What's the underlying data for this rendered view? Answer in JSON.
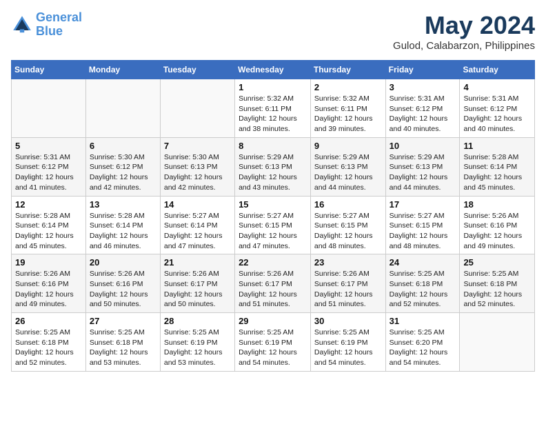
{
  "header": {
    "logo_line1": "General",
    "logo_line2": "Blue",
    "month": "May 2024",
    "location": "Gulod, Calabarzon, Philippines"
  },
  "weekdays": [
    "Sunday",
    "Monday",
    "Tuesday",
    "Wednesday",
    "Thursday",
    "Friday",
    "Saturday"
  ],
  "weeks": [
    [
      {
        "day": "",
        "info": ""
      },
      {
        "day": "",
        "info": ""
      },
      {
        "day": "",
        "info": ""
      },
      {
        "day": "1",
        "info": "Sunrise: 5:32 AM\nSunset: 6:11 PM\nDaylight: 12 hours\nand 38 minutes."
      },
      {
        "day": "2",
        "info": "Sunrise: 5:32 AM\nSunset: 6:11 PM\nDaylight: 12 hours\nand 39 minutes."
      },
      {
        "day": "3",
        "info": "Sunrise: 5:31 AM\nSunset: 6:12 PM\nDaylight: 12 hours\nand 40 minutes."
      },
      {
        "day": "4",
        "info": "Sunrise: 5:31 AM\nSunset: 6:12 PM\nDaylight: 12 hours\nand 40 minutes."
      }
    ],
    [
      {
        "day": "5",
        "info": "Sunrise: 5:31 AM\nSunset: 6:12 PM\nDaylight: 12 hours\nand 41 minutes."
      },
      {
        "day": "6",
        "info": "Sunrise: 5:30 AM\nSunset: 6:12 PM\nDaylight: 12 hours\nand 42 minutes."
      },
      {
        "day": "7",
        "info": "Sunrise: 5:30 AM\nSunset: 6:13 PM\nDaylight: 12 hours\nand 42 minutes."
      },
      {
        "day": "8",
        "info": "Sunrise: 5:29 AM\nSunset: 6:13 PM\nDaylight: 12 hours\nand 43 minutes."
      },
      {
        "day": "9",
        "info": "Sunrise: 5:29 AM\nSunset: 6:13 PM\nDaylight: 12 hours\nand 44 minutes."
      },
      {
        "day": "10",
        "info": "Sunrise: 5:29 AM\nSunset: 6:13 PM\nDaylight: 12 hours\nand 44 minutes."
      },
      {
        "day": "11",
        "info": "Sunrise: 5:28 AM\nSunset: 6:14 PM\nDaylight: 12 hours\nand 45 minutes."
      }
    ],
    [
      {
        "day": "12",
        "info": "Sunrise: 5:28 AM\nSunset: 6:14 PM\nDaylight: 12 hours\nand 45 minutes."
      },
      {
        "day": "13",
        "info": "Sunrise: 5:28 AM\nSunset: 6:14 PM\nDaylight: 12 hours\nand 46 minutes."
      },
      {
        "day": "14",
        "info": "Sunrise: 5:27 AM\nSunset: 6:14 PM\nDaylight: 12 hours\nand 47 minutes."
      },
      {
        "day": "15",
        "info": "Sunrise: 5:27 AM\nSunset: 6:15 PM\nDaylight: 12 hours\nand 47 minutes."
      },
      {
        "day": "16",
        "info": "Sunrise: 5:27 AM\nSunset: 6:15 PM\nDaylight: 12 hours\nand 48 minutes."
      },
      {
        "day": "17",
        "info": "Sunrise: 5:27 AM\nSunset: 6:15 PM\nDaylight: 12 hours\nand 48 minutes."
      },
      {
        "day": "18",
        "info": "Sunrise: 5:26 AM\nSunset: 6:16 PM\nDaylight: 12 hours\nand 49 minutes."
      }
    ],
    [
      {
        "day": "19",
        "info": "Sunrise: 5:26 AM\nSunset: 6:16 PM\nDaylight: 12 hours\nand 49 minutes."
      },
      {
        "day": "20",
        "info": "Sunrise: 5:26 AM\nSunset: 6:16 PM\nDaylight: 12 hours\nand 50 minutes."
      },
      {
        "day": "21",
        "info": "Sunrise: 5:26 AM\nSunset: 6:17 PM\nDaylight: 12 hours\nand 50 minutes."
      },
      {
        "day": "22",
        "info": "Sunrise: 5:26 AM\nSunset: 6:17 PM\nDaylight: 12 hours\nand 51 minutes."
      },
      {
        "day": "23",
        "info": "Sunrise: 5:26 AM\nSunset: 6:17 PM\nDaylight: 12 hours\nand 51 minutes."
      },
      {
        "day": "24",
        "info": "Sunrise: 5:25 AM\nSunset: 6:18 PM\nDaylight: 12 hours\nand 52 minutes."
      },
      {
        "day": "25",
        "info": "Sunrise: 5:25 AM\nSunset: 6:18 PM\nDaylight: 12 hours\nand 52 minutes."
      }
    ],
    [
      {
        "day": "26",
        "info": "Sunrise: 5:25 AM\nSunset: 6:18 PM\nDaylight: 12 hours\nand 52 minutes."
      },
      {
        "day": "27",
        "info": "Sunrise: 5:25 AM\nSunset: 6:18 PM\nDaylight: 12 hours\nand 53 minutes."
      },
      {
        "day": "28",
        "info": "Sunrise: 5:25 AM\nSunset: 6:19 PM\nDaylight: 12 hours\nand 53 minutes."
      },
      {
        "day": "29",
        "info": "Sunrise: 5:25 AM\nSunset: 6:19 PM\nDaylight: 12 hours\nand 54 minutes."
      },
      {
        "day": "30",
        "info": "Sunrise: 5:25 AM\nSunset: 6:19 PM\nDaylight: 12 hours\nand 54 minutes."
      },
      {
        "day": "31",
        "info": "Sunrise: 5:25 AM\nSunset: 6:20 PM\nDaylight: 12 hours\nand 54 minutes."
      },
      {
        "day": "",
        "info": ""
      }
    ]
  ]
}
